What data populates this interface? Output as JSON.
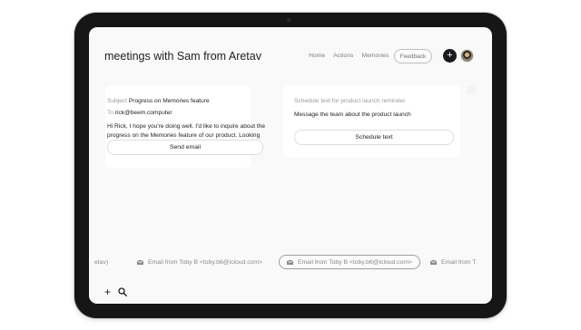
{
  "header": {
    "title": "meetings with Sam from Aretav",
    "nav": [
      "Home",
      "Actions",
      "Memories"
    ],
    "feedback_label": "Feedback",
    "add_icon": "plus-icon",
    "avatar_icon": "user-avatar"
  },
  "email_card": {
    "subject_label": "Subject",
    "subject": "Progress on Memories feature",
    "to_label": "To",
    "to": "rick@beem.computer",
    "body": "Hi Rick, I hope you're doing well. I'd like to inquire about the progress on the Memories feature of our product. Looking",
    "send_label": "Send email"
  },
  "schedule_card": {
    "title": "Schedule text for product launch reminder",
    "body": "Message the team about the product launch",
    "button_label": "Schedule text"
  },
  "strip": {
    "items": [
      {
        "text": "etav)",
        "icon": ""
      },
      {
        "text": "Email from Toby B <toby.b6@icloud.com>",
        "icon": "mail-icon"
      },
      {
        "text": "Email from Toby B <toby.b6@icloud.com>",
        "icon": "mail-icon",
        "active": true
      },
      {
        "text": "Email from T",
        "icon": "mail-icon"
      }
    ]
  },
  "bottom": {
    "add_label": "+",
    "search_icon": "search-icon"
  },
  "colors": {
    "device_frame": "#161616",
    "screen_bg": "#f9f9f9",
    "card_bg": "#ffffff",
    "accent_dark": "#1b1b1b"
  }
}
